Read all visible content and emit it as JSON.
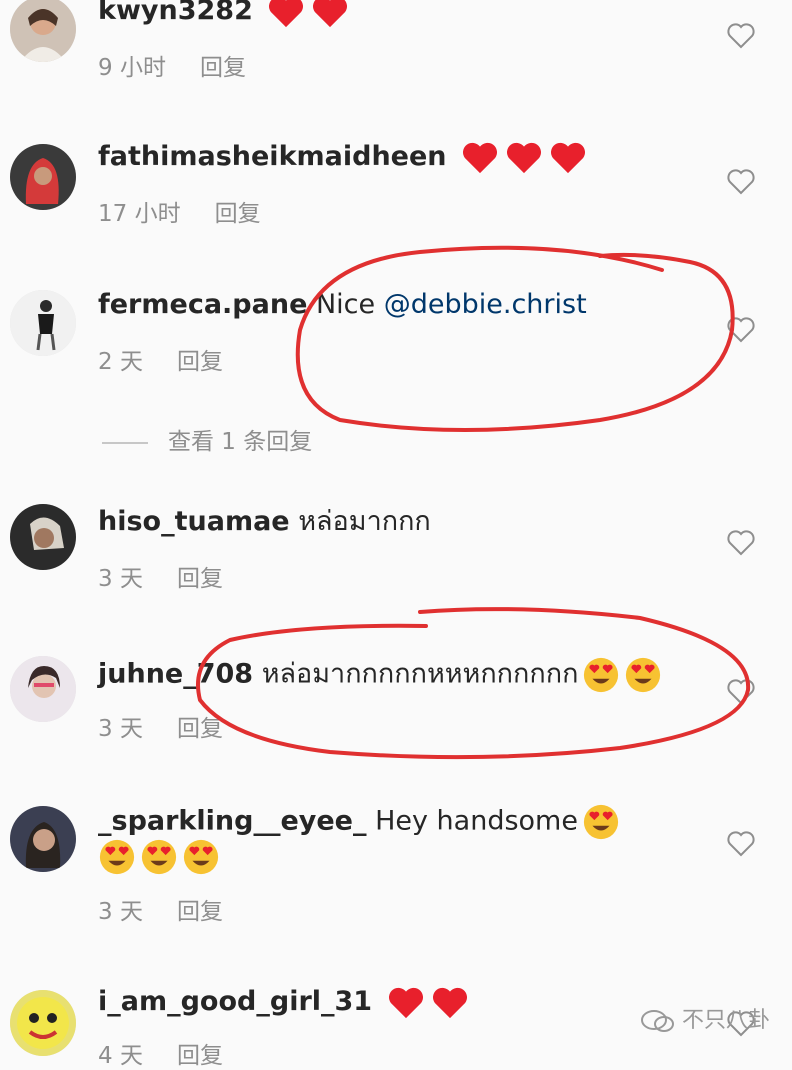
{
  "comments": [
    {
      "username": "kwyn3282",
      "text": "",
      "emojis": [
        "red-heart",
        "red-heart"
      ],
      "time": "9 小时",
      "reply": "回复"
    },
    {
      "username": "fathimasheikmaidheen",
      "text": "",
      "emojis": [
        "red-heart",
        "red-heart",
        "red-heart"
      ],
      "time": "17 小时",
      "reply": "回复"
    },
    {
      "username": "fermeca.pane",
      "text": "Nice ",
      "mention": "@debbie.christ",
      "emojis": [],
      "time": "2 天",
      "reply": "回复"
    },
    {
      "username": "hiso_tuamae",
      "text": "หล่อมากกก",
      "emojis": [],
      "time": "3 天",
      "reply": "回复"
    },
    {
      "username": "juhne_708",
      "text": "หล่อมากกกกกหหหกกกกกก",
      "emojis": [
        "heart-eyes",
        "heart-eyes"
      ],
      "time": "3 天",
      "reply": "回复"
    },
    {
      "username": "_sparkling__eyee_",
      "text": "Hey handsome",
      "emojis": [
        "heart-eyes",
        "heart-eyes",
        "heart-eyes",
        "heart-eyes"
      ],
      "time": "3 天",
      "reply": "回复"
    },
    {
      "username": "i_am_good_girl_31",
      "text": "",
      "emojis": [
        "red-heart",
        "red-heart"
      ],
      "time": "4 天",
      "reply": "回复"
    }
  ],
  "view_replies": "查看 1 条回复",
  "watermark": "不只八卦",
  "colors": {
    "annotation": "#e03030",
    "heart": "#e8202c",
    "meta": "#8e8e8e"
  }
}
